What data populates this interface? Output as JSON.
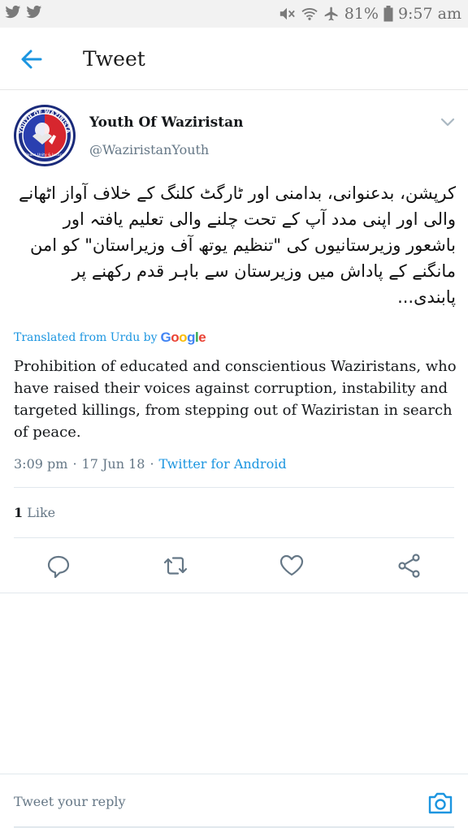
{
  "status_bar": {
    "battery": "81%",
    "time": "9:57 am",
    "icons": [
      "twitter-icon",
      "twitter-icon",
      "mute-icon",
      "wifi-icon",
      "airplane-icon",
      "battery-icon"
    ]
  },
  "header": {
    "title": "Tweet",
    "back_icon": "arrow-left-icon"
  },
  "tweet": {
    "author_name": "Youth Of Waziristan",
    "handle": "@WaziristanYouth",
    "avatar_text": "YOUTH OF WAZIRISTAN",
    "avatar_motto": "Peace Unity & Justice",
    "original_text": "کرپشن، بدعنوانی، بدامنی اور ٹارگٹ کلنگ کے خلاف آواز اٹھانے والی اور اپنی مدد آپ کے تحت چلنے والی تعلیم یافتہ اور باشعور وزیرستانیوں کی \"تنظیم یوتھ آف وزیراستان\" کو امن مانگنے کے پاداش میں وزیرستان سے باہر قدم رکھنے پر پابندی...",
    "translated_label": "Translated from Urdu by",
    "translator": "Google",
    "translation": "Prohibition of educated and conscientious Waziristans, who have raised their voices against corruption, instability and targeted killings, from stepping out of Waziristan in search of peace.",
    "time": "3:09 pm",
    "date": "17 Jun 18",
    "dot": "·",
    "source": "Twitter for Android",
    "like_count": "1",
    "like_label": "Like"
  },
  "actions": [
    "reply-icon",
    "retweet-icon",
    "like-icon",
    "share-icon"
  ],
  "reply": {
    "placeholder": "Tweet your reply"
  },
  "colors": {
    "accent": "#1b95e0",
    "muted": "#657786",
    "divider": "#e1e8ed"
  }
}
